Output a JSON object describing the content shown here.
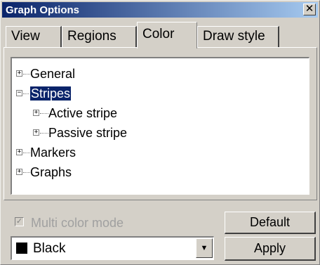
{
  "window": {
    "title": "Graph Options",
    "close_glyph": "✕"
  },
  "tabs": [
    {
      "label": "View",
      "active": false
    },
    {
      "label": "Regions",
      "active": false
    },
    {
      "label": "Color",
      "active": true
    },
    {
      "label": "Draw style",
      "active": false
    }
  ],
  "tree": {
    "items": [
      {
        "label": "General",
        "expander": "+",
        "level": 0
      },
      {
        "label": "Stripes",
        "expander": "−",
        "level": 0,
        "selected": true
      },
      {
        "label": "Active stripe",
        "expander": "+",
        "level": 1
      },
      {
        "label": "Passive stripe",
        "expander": "+",
        "level": 1
      },
      {
        "label": "Markers",
        "expander": "+",
        "level": 0
      },
      {
        "label": "Graphs",
        "expander": "+",
        "level": 0
      }
    ]
  },
  "multi_color_mode": {
    "label": "Multi color mode",
    "checked": true,
    "check_glyph": "✓",
    "enabled": false
  },
  "buttons": {
    "default_label": "Default",
    "apply_label": "Apply"
  },
  "color_select": {
    "value": "Black",
    "swatch_color": "#000000",
    "arrow_glyph": "▼"
  },
  "colors": {
    "title_bar_start": "#0a246a",
    "title_bar_end": "#a6caf0",
    "selection": "#0a246a",
    "face": "#d4d0c8"
  }
}
